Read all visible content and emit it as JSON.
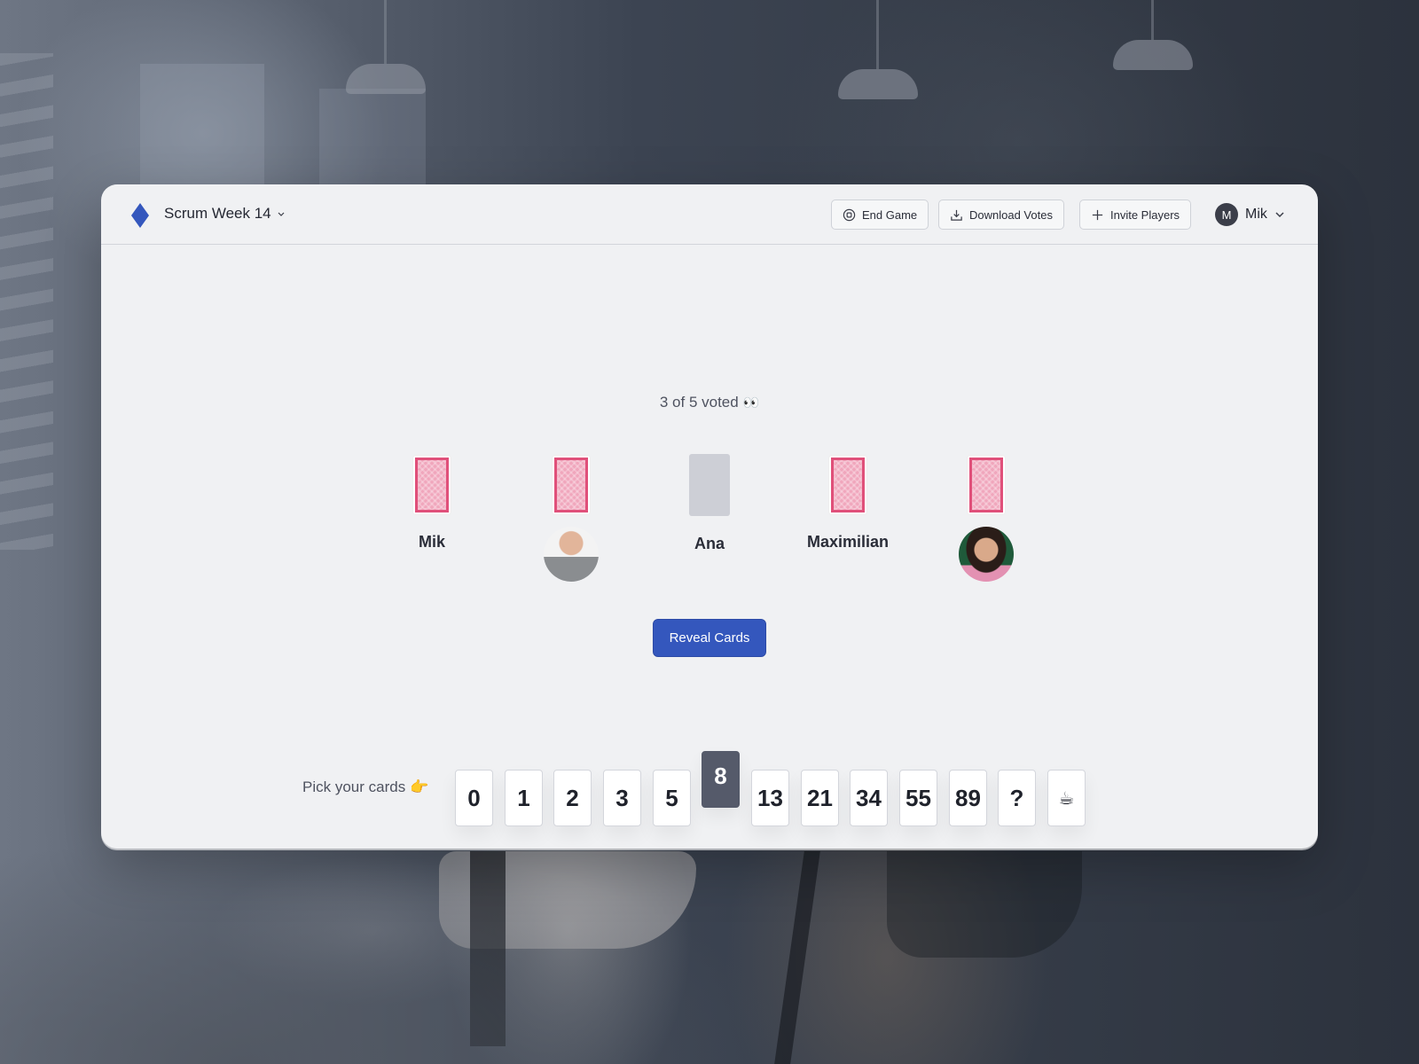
{
  "header": {
    "game_title": "Scrum Week 14",
    "buttons": {
      "end_game": "End Game",
      "download_votes": "Download Votes",
      "invite_players": "Invite Players"
    },
    "user": {
      "initial": "M",
      "name": "Mik"
    }
  },
  "table": {
    "status_text": "3 of 5 voted",
    "status_emoji": "👀",
    "players": [
      {
        "name": "Mik",
        "has_voted": true,
        "display": "name"
      },
      {
        "name": "",
        "has_voted": true,
        "display": "avatar"
      },
      {
        "name": "Ana",
        "has_voted": false,
        "display": "name"
      },
      {
        "name": "Maximilian",
        "has_voted": true,
        "display": "name"
      },
      {
        "name": "",
        "has_voted": true,
        "display": "avatar"
      }
    ],
    "reveal_label": "Reveal Cards"
  },
  "deck": {
    "label": "Pick your cards",
    "label_emoji": "👉",
    "cards": [
      "0",
      "1",
      "2",
      "3",
      "5",
      "8",
      "13",
      "21",
      "34",
      "55",
      "89",
      "?",
      "☕"
    ],
    "selected": "8"
  },
  "colors": {
    "accent": "#3457bd",
    "selected_card": "#555a6a",
    "card_back": "#e0507a"
  }
}
